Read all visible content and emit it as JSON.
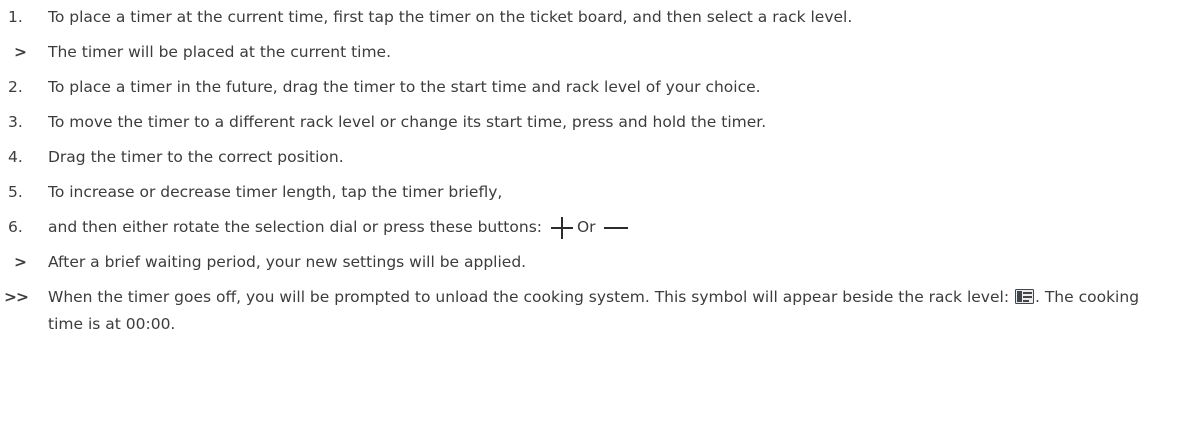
{
  "steps": [
    {
      "marker": "1.",
      "text": "To place a timer at the current time, first tap the timer on the ticket board, and then select a rack level."
    },
    {
      "marker": ">",
      "text": "The timer will be placed at the current time."
    },
    {
      "marker": "2.",
      "text": "To place a timer in the future, drag the timer to the start time and rack level of your choice."
    },
    {
      "marker": "3.",
      "text": "To move the timer to a different rack level or change its start time, press and hold the timer."
    },
    {
      "marker": "4.",
      "text": "Drag the timer to the correct position."
    },
    {
      "marker": "5.",
      "text": "To increase or decrease timer length, tap the timer briefly,"
    },
    {
      "marker": "6.",
      "text": "and then either rotate the selection dial or press these buttons:",
      "or_label": "Or",
      "icons": [
        "plus-icon",
        "minus-icon"
      ]
    },
    {
      "marker": ">",
      "text": "After a brief waiting period, your new settings will be applied."
    },
    {
      "marker": ">>",
      "text_before": "When the timer goes off, you will be prompted to unload the cooking system. This symbol will appear beside the rack level:",
      "text_after": ". The cooking time is at 00:00.",
      "icon": "unload-rack-icon"
    }
  ]
}
